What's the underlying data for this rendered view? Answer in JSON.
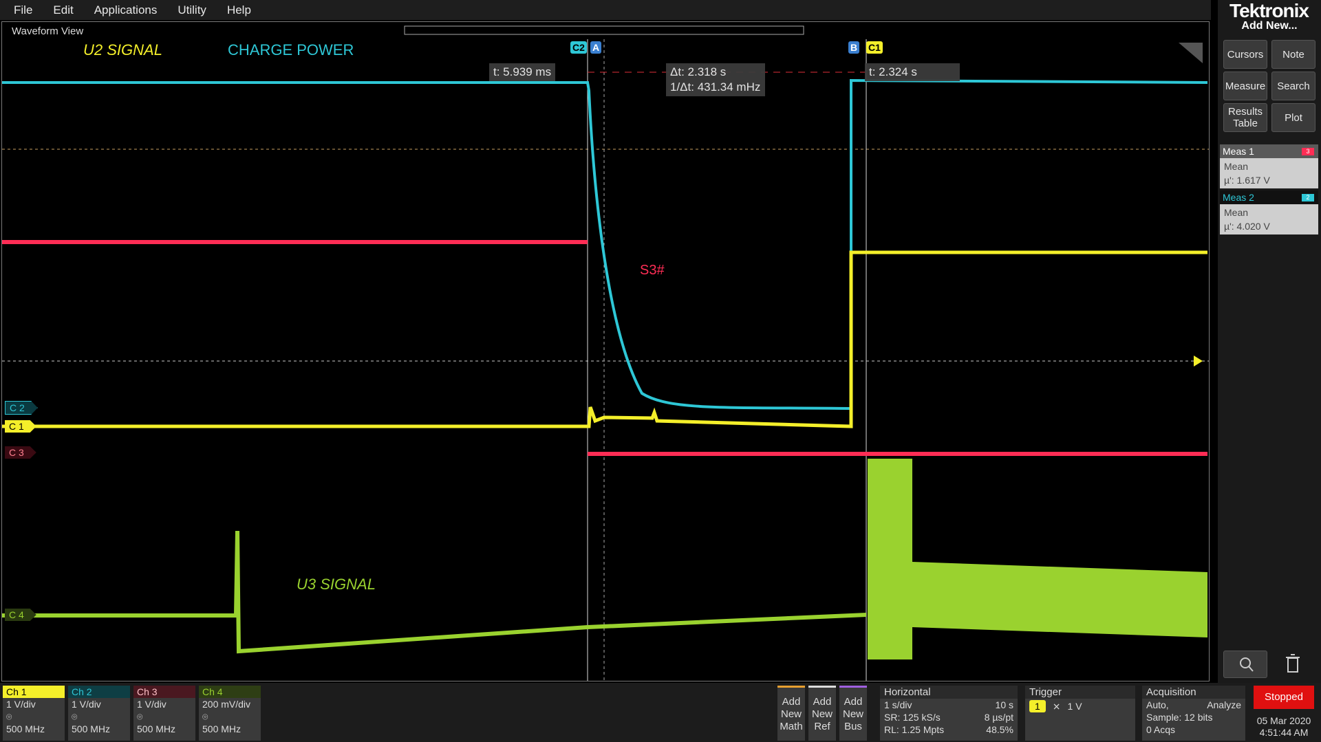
{
  "menu": [
    "File",
    "Edit",
    "Applications",
    "Utility",
    "Help"
  ],
  "brand": "Tektronix",
  "right_panel": {
    "add_new": "Add New...",
    "buttons": {
      "cursors": "Cursors",
      "note": "Note",
      "measure": "Measure",
      "search": "Search",
      "results_table": "Results Table",
      "plot": "Plot"
    },
    "meas1": {
      "title": "Meas 1",
      "badge": "3",
      "stat": "Mean",
      "value": "µ': 1.617 V"
    },
    "meas2": {
      "title": "Meas 2",
      "badge": "2",
      "stat": "Mean",
      "value": "µ': 4.020 V"
    }
  },
  "waveform": {
    "title": "Waveform View",
    "labels": {
      "u2": "U2 SIGNAL",
      "charge": "CHARGE POWER",
      "s3": "S3#",
      "u3": "U3 SIGNAL"
    },
    "cursor_a_time": "t: 5.939 ms",
    "cursor_b_time": "t: 2.324 s",
    "delta_t": "Δt: 2.318 s",
    "inv_delta_t": "1/Δt: 431.34 mHz",
    "cursor_tags": {
      "c2": "C2",
      "a": "A",
      "b": "B",
      "c1": "C1"
    },
    "channel_tags": {
      "c1": "C 1",
      "c2": "C 2",
      "c3": "C 3",
      "c4": "C 4"
    },
    "colors": {
      "ch1": "#f4ef2a",
      "ch2": "#2ec7d6",
      "ch3": "#ff2d55",
      "ch4": "#9ad22f"
    }
  },
  "bottom": {
    "channels": [
      {
        "name": "Ch 1",
        "scale": "1 V/div",
        "bw": "500 MHz",
        "color": "#f4ef2a"
      },
      {
        "name": "Ch 2",
        "scale": "1 V/div",
        "bw": "500 MHz",
        "color": "#2ec7d6"
      },
      {
        "name": "Ch 3",
        "scale": "1 V/div",
        "bw": "500 MHz",
        "color": "#ff2d55"
      },
      {
        "name": "Ch 4",
        "scale": "200 mV/div",
        "bw": "500 MHz",
        "color": "#9ad22f"
      }
    ],
    "add_math": "Add New Math",
    "add_ref": "Add New Ref",
    "add_bus": "Add New Bus",
    "horizontal": {
      "title": "Horizontal",
      "scale": "1 s/div",
      "duration": "10 s",
      "sr": "SR: 125 kS/s",
      "pt": "8 µs/pt",
      "rl": "RL: 1.25 Mpts",
      "pos": "48.5%"
    },
    "trigger": {
      "title": "Trigger",
      "source": "1",
      "level": "1 V"
    },
    "acquisition": {
      "title": "Acquisition",
      "mode": "Auto,",
      "analyze": "Analyze",
      "sample": "Sample: 12 bits",
      "acqs": "0 Acqs"
    },
    "status": "Stopped",
    "date": "05 Mar 2020",
    "time": "4:51:44 AM"
  }
}
